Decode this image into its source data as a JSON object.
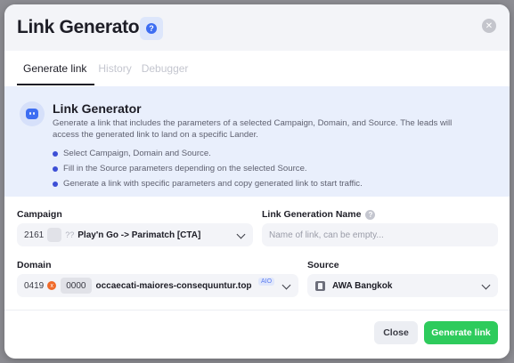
{
  "modal": {
    "title": "Link Generator",
    "help_icon": "question-circle-icon",
    "close_icon": "close-x-icon"
  },
  "tabs": [
    {
      "label": "Generate link",
      "active": true
    },
    {
      "label": "History",
      "active": false
    },
    {
      "label": "Debugger",
      "active": false
    }
  ],
  "info": {
    "icon": "robot-icon",
    "title": "Link Generator",
    "description": "Generate a link that includes the parameters of a selected Campaign, Domain, and Source. The leads will access the generated link to land on a specific Lander.",
    "items": [
      "Select Campaign, Domain and Source.",
      "Fill in the Source parameters depending on the selected Source.",
      "Generate a link with specific parameters and copy generated link to start traffic."
    ]
  },
  "form": {
    "campaign": {
      "label": "Campaign",
      "id": "2161",
      "unknown_marks": "??",
      "name": "Play'n Go -> Parimatch [CTA]"
    },
    "link_name": {
      "label": "Link Generation Name",
      "placeholder": "Name of link, can be empty..."
    },
    "domain": {
      "label": "Domain",
      "id": "0419",
      "status_icon": "x",
      "chip": "0000",
      "name": "occaecati-maiores-consequuntur.top",
      "badge": "AIO"
    },
    "source": {
      "label": "Source",
      "icon": "source-icon",
      "name": "AWA Bangkok"
    }
  },
  "footer": {
    "close_label": "Close",
    "generate_label": "Generate link"
  },
  "colors": {
    "accent_blue": "#3d6df2",
    "generate_green": "#2ecb5c",
    "info_bg": "#e9effc",
    "domain_status": "#f06a2a"
  }
}
